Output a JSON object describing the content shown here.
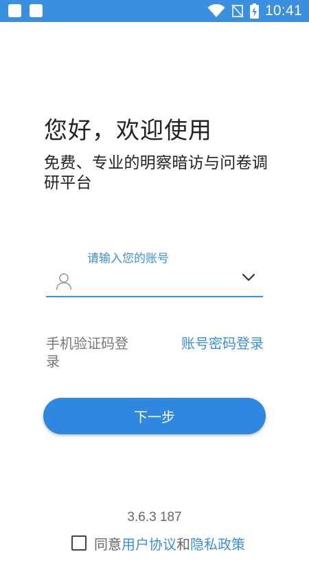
{
  "status_bar": {
    "time": "10:41",
    "icons": [
      "notification-square-icon",
      "notification-square-icon",
      "wifi-icon",
      "no-signal-icon",
      "battery-charging-icon"
    ],
    "background": "#3b8fe0"
  },
  "welcome": {
    "greeting": "您好，欢迎使用",
    "subtitle": "免费、专业的明察暗访与问卷调研平台"
  },
  "account": {
    "label": "请输入您的账号",
    "value": "",
    "placeholder": "",
    "icon": "user-icon",
    "dropdown_icon": "chevron-down-icon"
  },
  "login_options": {
    "sms": "手机验证码登录",
    "password": "账号密码登录"
  },
  "actions": {
    "next": "下一步"
  },
  "footer": {
    "version": "3.6.3 187",
    "agree_prefix": "同意",
    "user_agreement": "用户协议",
    "and": "和",
    "privacy_policy": "隐私政策",
    "checked": false
  },
  "colors": {
    "accent": "#3b8fe0",
    "button": "#2f88e0",
    "text_primary": "#222222",
    "text_secondary": "#777777"
  }
}
